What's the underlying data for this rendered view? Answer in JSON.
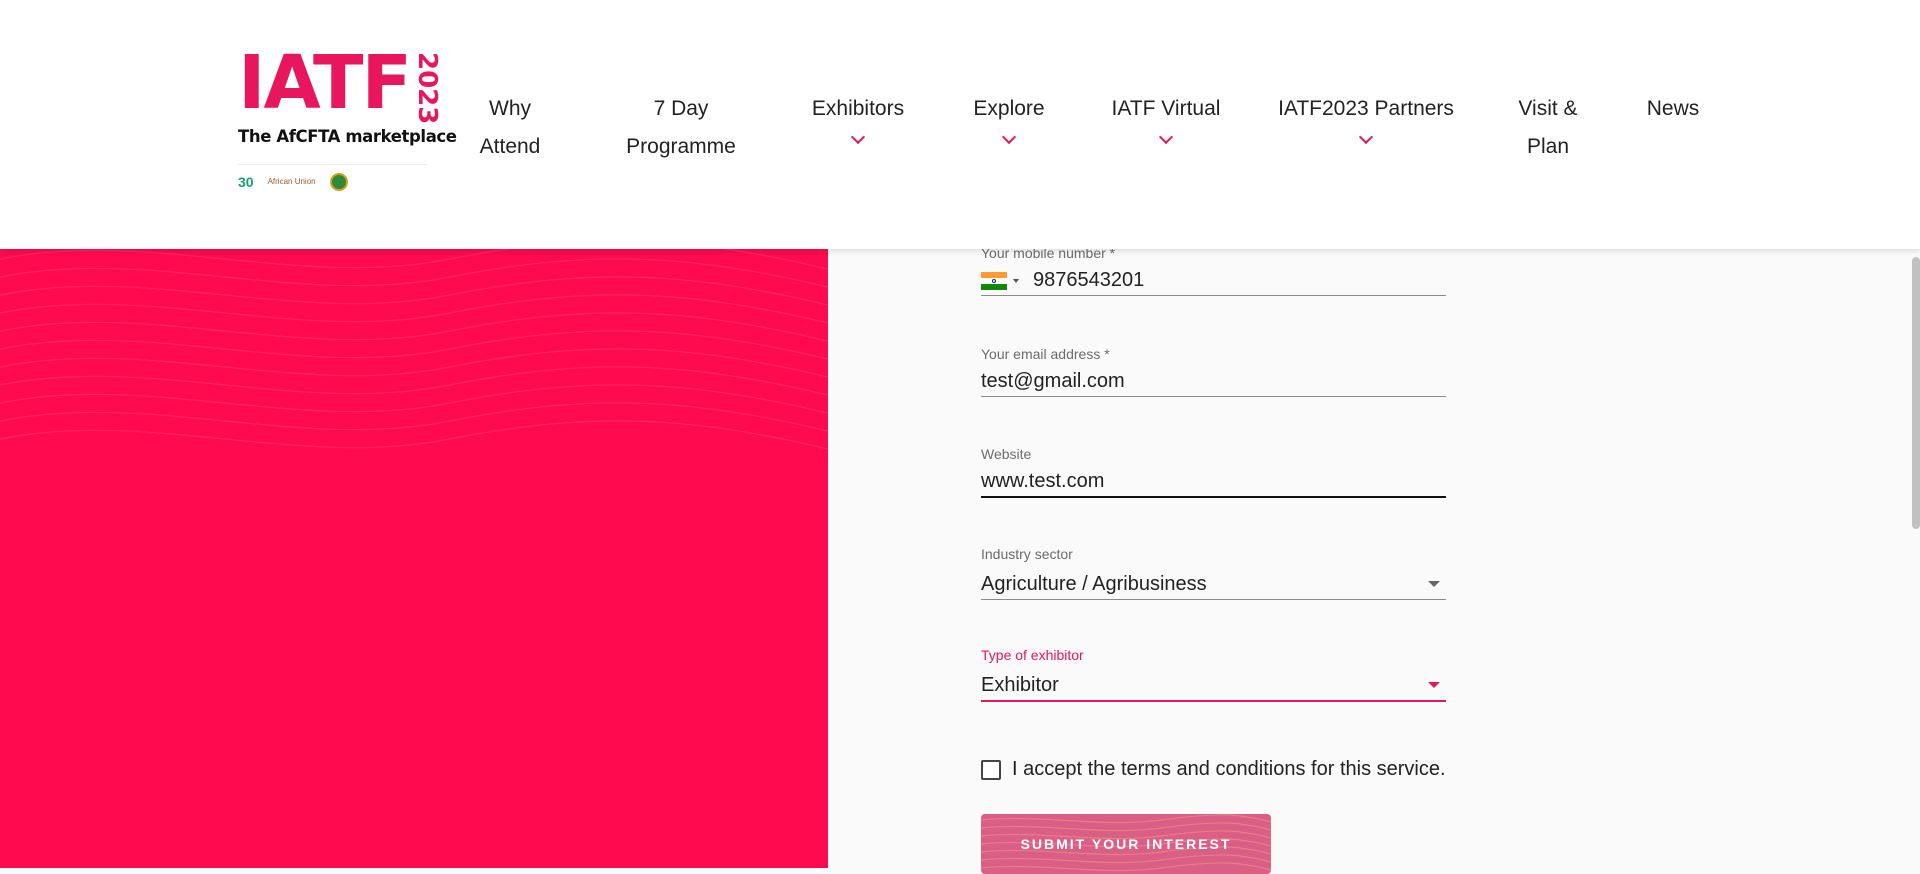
{
  "logo": {
    "text": "IATF",
    "year": "2023",
    "tagline": "The AfCFTA marketplace",
    "partners": [
      "30",
      "African Union"
    ]
  },
  "nav": {
    "items": [
      {
        "label": "Why Attend",
        "line1": "Why",
        "line2": "Attend",
        "has_dropdown": false
      },
      {
        "label": "7 Day Programme",
        "line1": "7 Day",
        "line2": "Programme",
        "has_dropdown": false
      },
      {
        "label": "Exhibitors",
        "has_dropdown": true
      },
      {
        "label": "Explore",
        "has_dropdown": true
      },
      {
        "label": "IATF Virtual",
        "has_dropdown": true
      },
      {
        "label": "IATF2023 Partners",
        "has_dropdown": true
      },
      {
        "label": "Visit & Plan",
        "line1": "Visit &",
        "line2": "Plan",
        "has_dropdown": false
      },
      {
        "label": "News",
        "has_dropdown": false
      }
    ]
  },
  "form": {
    "mobile": {
      "label": "Your mobile number *",
      "country": "India",
      "value": "9876543201"
    },
    "email": {
      "label": "Your email address *",
      "value": "test@gmail.com"
    },
    "website": {
      "label": "Website",
      "value": "www.test.com"
    },
    "industry": {
      "label": "Industry sector",
      "value": "Agriculture / Agribusiness"
    },
    "exhibitor_type": {
      "label": "Type of exhibitor",
      "value": "Exhibitor"
    },
    "terms": {
      "label": "I accept the terms and conditions for this service.",
      "checked": false
    },
    "submit_label": "SUBMIT YOUR INTEREST"
  },
  "colors": {
    "brand": "#e8175d",
    "panel": "#ff0a4e",
    "button": "#d95f86"
  }
}
